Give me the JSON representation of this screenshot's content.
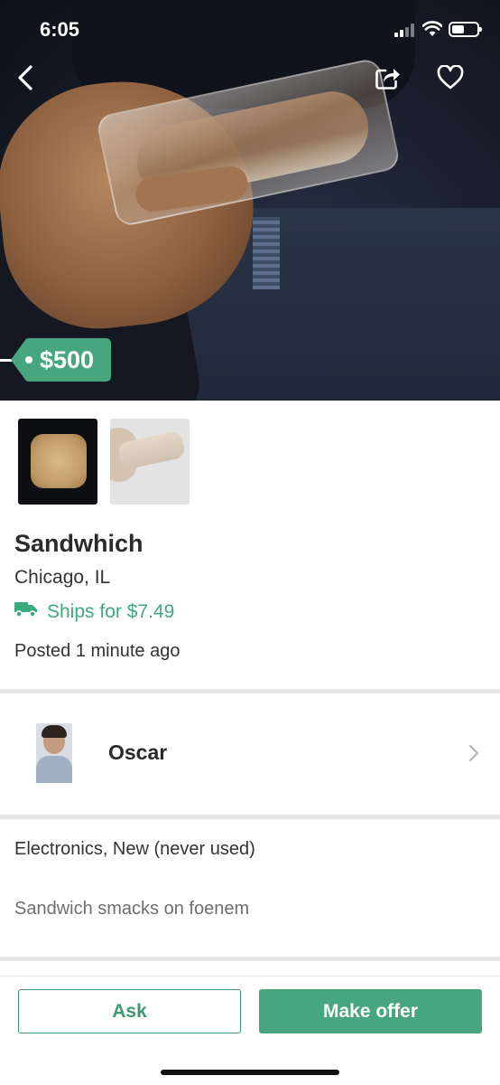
{
  "status_bar": {
    "time": "6:05",
    "icons": [
      "cellular-signal-icon",
      "wifi-icon",
      "battery-icon"
    ]
  },
  "nav": {
    "icons": [
      "chevron-left-icon",
      "share-icon",
      "heart-icon"
    ]
  },
  "listing": {
    "price": "$500",
    "title": "Sandwhich",
    "location": "Chicago, IL",
    "shipping": "Ships for $7.49",
    "posted": "Posted 1 minute ago",
    "condition": "Electronics, New (never used)",
    "description": "Sandwich smacks on foenem"
  },
  "seller": {
    "name": "Oscar"
  },
  "actions": {
    "ask_label": "Ask",
    "offer_label": "Make offer"
  },
  "colors": {
    "accent": "#47a67e",
    "accent_text": "#3daa7d"
  }
}
